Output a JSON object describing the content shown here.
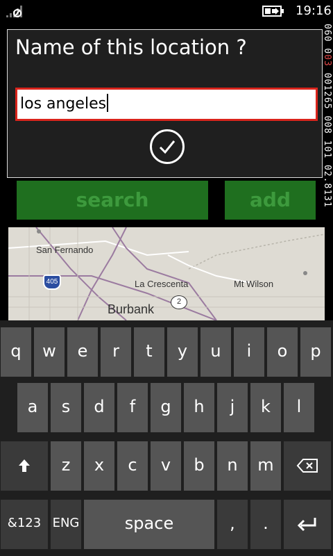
{
  "status": {
    "time": "19:16",
    "signal_icon": "signal-off-icon",
    "battery_icon": "battery-charging-icon"
  },
  "debug_overlay": {
    "text_before": "060 0",
    "text_highlight": "03 ",
    "text_after": "001265 008 101 02.8131"
  },
  "dialog": {
    "title": "Name of this location ?",
    "input_value": "los angeles",
    "confirm_icon": "checkmark-icon"
  },
  "actions": {
    "search_label": "search",
    "add_label": "add"
  },
  "map": {
    "labels": [
      "San Fernando",
      "La Crescenta",
      "Mt Wilson",
      "Burbank"
    ],
    "shields": [
      "405",
      "2"
    ]
  },
  "keyboard": {
    "row1": [
      "q",
      "w",
      "e",
      "r",
      "t",
      "y",
      "u",
      "i",
      "o",
      "p"
    ],
    "row2": [
      "a",
      "s",
      "d",
      "f",
      "g",
      "h",
      "j",
      "k",
      "l"
    ],
    "row3": [
      "z",
      "x",
      "c",
      "v",
      "b",
      "n",
      "m"
    ],
    "row4": {
      "symbols": "&123",
      "language": "ENG",
      "space": "space",
      "comma": ",",
      "period": "."
    },
    "colors": {
      "key": "#555555",
      "key_dark": "#3a3a3a",
      "background": "#1f1f1f"
    }
  },
  "colors": {
    "button_bg": "#1f6f1f",
    "button_text": "#3d9a3d",
    "input_border": "#d9241c",
    "dialog_bg": "#1f1f1f"
  }
}
